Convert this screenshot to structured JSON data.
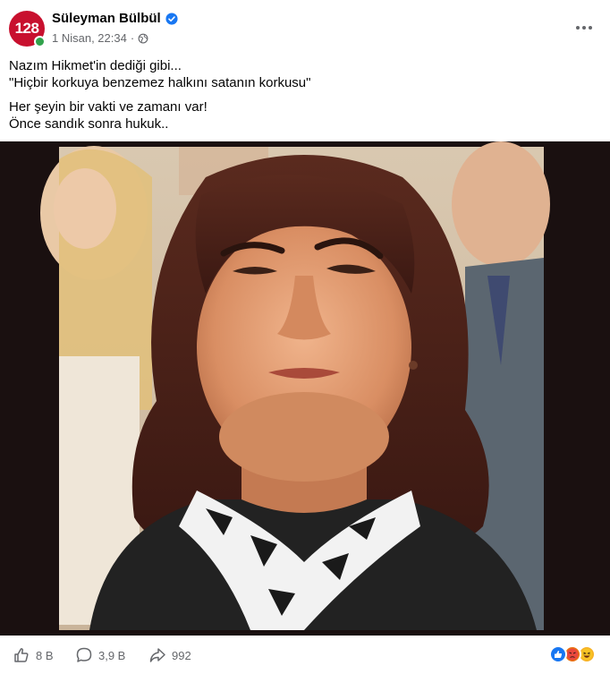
{
  "post": {
    "author": {
      "avatar_text": "128",
      "name": "Süleyman Bülbül",
      "verified": true
    },
    "meta": {
      "date": "1 Nisan, 22:34",
      "separator": "·",
      "audience_icon": "globe-icon"
    },
    "text": {
      "line1": "Nazım Hikmet'in dediği gibi...",
      "line2": "\"Hiçbir korkuya benzemez halkını satanın korkusu\"",
      "line3": "Her şeyin bir vakti ve zamanı var!",
      "line4": "Önce sandık sonra hukuk.."
    },
    "stats": {
      "likes": "8 B",
      "comments": "3,9 B",
      "shares": "992"
    },
    "reactions": [
      "like-reaction-icon",
      "angry-reaction-icon",
      "haha-reaction-icon"
    ]
  },
  "colors": {
    "brand_red": "#c8102e",
    "verified_blue": "#1877f2",
    "online_green": "#31a24c",
    "meta_gray": "#65676b"
  }
}
